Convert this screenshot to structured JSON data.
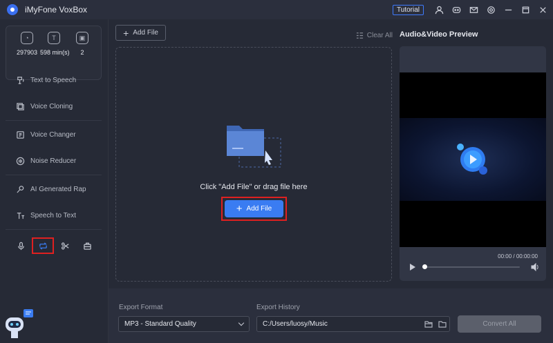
{
  "app": {
    "title": "iMyFone VoxBox",
    "tutorial_label": "Tutorial"
  },
  "titlebar_icons": [
    "user-icon",
    "discord-icon",
    "mail-icon",
    "settings-icon",
    "minimize-icon",
    "maximize-icon",
    "close-icon"
  ],
  "stats": [
    {
      "icon": "character-count-icon",
      "value": "297903"
    },
    {
      "icon": "minutes-icon",
      "value": "598 min(s)"
    },
    {
      "icon": "clone-count-icon",
      "value": "2"
    }
  ],
  "sidebar": {
    "items": [
      {
        "icon": "text-to-speech-icon",
        "label": "Text to Speech"
      },
      {
        "icon": "voice-cloning-icon",
        "label": "Voice Cloning"
      },
      {
        "icon": "voice-changer-icon",
        "label": "Voice Changer"
      },
      {
        "icon": "noise-reducer-icon",
        "label": "Noise Reducer"
      },
      {
        "icon": "ai-rap-icon",
        "label": "AI Generated Rap"
      },
      {
        "icon": "speech-to-text-icon",
        "label": "Speech to Text"
      }
    ],
    "tools": [
      "microphone-icon",
      "convert-icon",
      "cut-icon",
      "toolbox-icon"
    ]
  },
  "main": {
    "add_file_top": "Add File",
    "clear_all": "Clear All",
    "drop_text": "Click \"Add File\" or drag file here",
    "add_file_main": "Add File"
  },
  "preview": {
    "title": "Audio&Video Preview",
    "time": "00:00 / 00:00:00",
    "progress": 0.0
  },
  "bottom": {
    "format_label": "Export Format",
    "format_value": "MP3 - Standard Quality",
    "history_label": "Export History",
    "history_value": "C:/Users/luosy/Music",
    "convert_label": "Convert All"
  },
  "colors": {
    "accent": "#3a7cf2",
    "highlight_box": "#e02020",
    "background": "#262a36"
  }
}
